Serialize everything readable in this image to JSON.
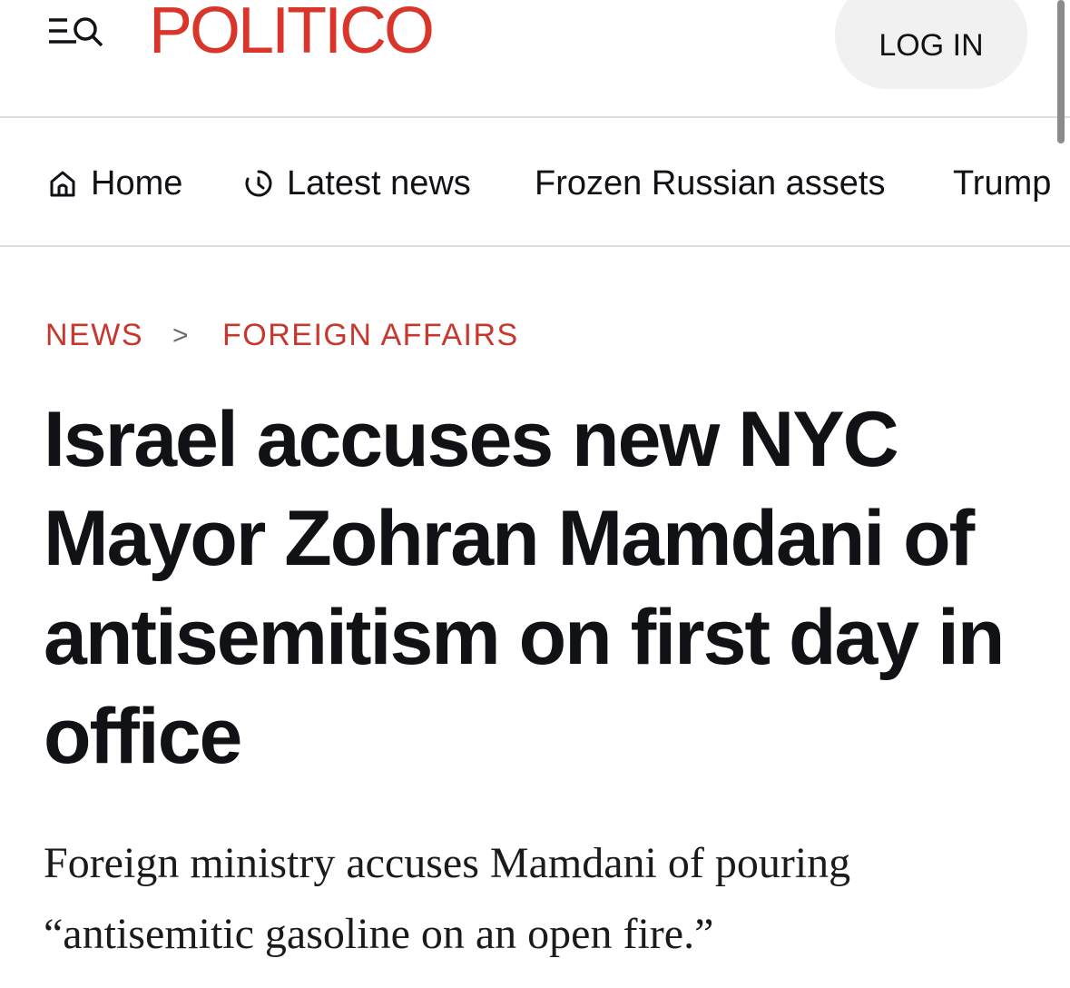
{
  "header": {
    "logo_text": "POLITICO",
    "login_label": "LOG IN",
    "menu_icon": "menu-search-icon",
    "brand_color": "#d9352a"
  },
  "nav": {
    "items": [
      {
        "label": "Home",
        "icon": "home-icon"
      },
      {
        "label": "Latest news",
        "icon": "clock-icon"
      },
      {
        "label": "Frozen Russian assets"
      },
      {
        "label": "Trump"
      }
    ]
  },
  "article": {
    "breadcrumb": [
      "NEWS",
      "FOREIGN AFFAIRS"
    ],
    "breadcrumb_separator": ">",
    "headline": "Israel accuses new NYC Mayor Zohran Mamdani of antisemitism on first day in office",
    "dek": "Foreign ministry accuses Mamdani of pouring “antisemitic gasoline on an open fire.”",
    "accent_color": "#c8372d"
  }
}
